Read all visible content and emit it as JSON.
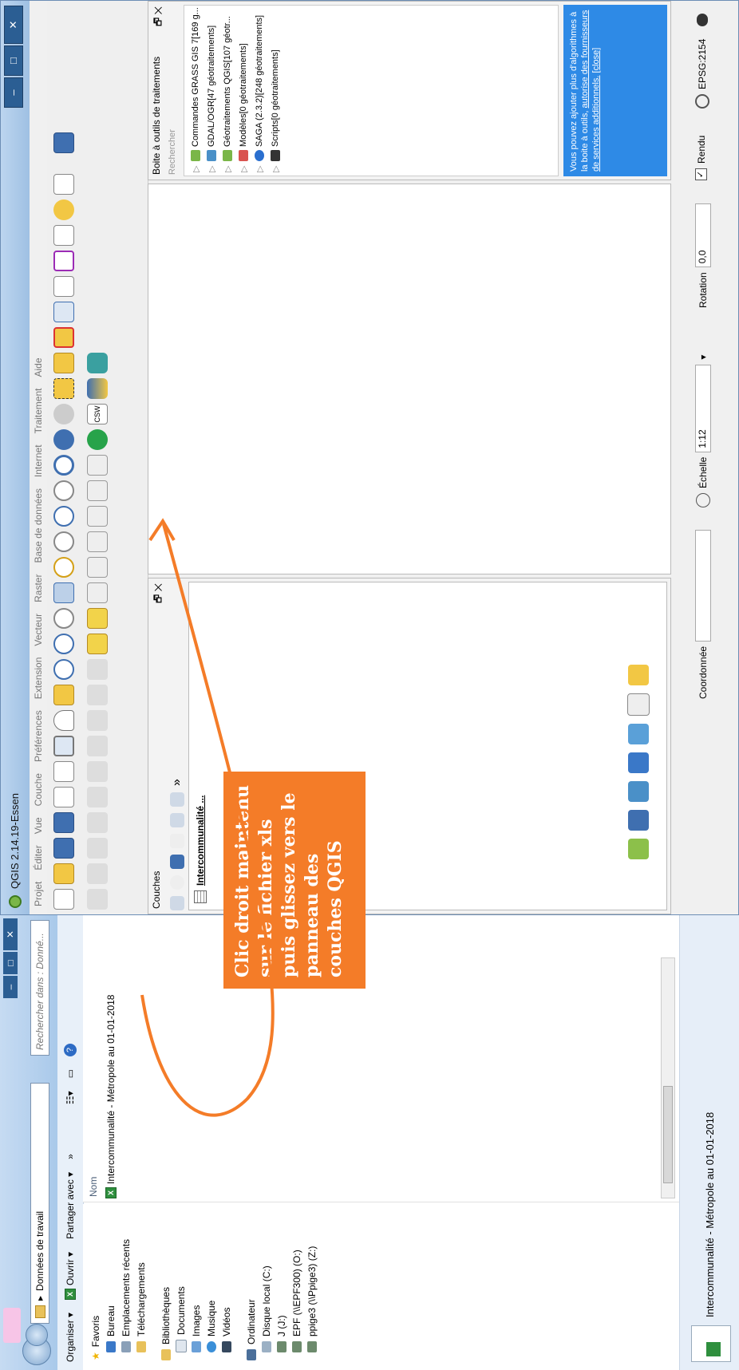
{
  "qgis": {
    "title": "QGIS 2.14.19-Essen",
    "window_buttons": [
      "–",
      "□",
      "✕"
    ],
    "menu": [
      "Projet",
      "Éditer",
      "Vue",
      "Couche",
      "Préférences",
      "Extension",
      "Vecteur",
      "Raster",
      "Base de données",
      "Internet",
      "Traitement",
      "Aide"
    ],
    "layers_panel": {
      "title": "Couches",
      "float_close": "🗗 ✕",
      "more": "»",
      "layer_name": "Intercommunalité ..."
    },
    "processing_panel": {
      "title": "Boite à outils de traitements",
      "float_close": "🗗 ✕",
      "search_placeholder": "Rechercher",
      "items": [
        "Commandes GRASS GIS 7[169 g...",
        "GDAL/OGR[47 géotraitements]",
        "Géotraitements QGIS[107 géotr...",
        "Modèles[0 géotraitements]",
        "SAGA (2.3.2)[248 géotraitements]",
        "Scripts[0 géotraitements]"
      ],
      "notice_text": "Vous pouvez ajouter plus d'algorithmes à la boite à outils,",
      "notice_link": "autorise des fournisseurs de services additionnels.",
      "notice_close": "[close]"
    },
    "status": {
      "coord_label": "Coordonnée",
      "coord_value": "",
      "scale_label": "Échelle",
      "scale_value": "1:12",
      "rotation_label": "Rotation",
      "rotation_value": "0,0",
      "render_label": "Rendu",
      "crs": "EPSG:2154"
    }
  },
  "explorer": {
    "window_buttons": [
      "–",
      "□",
      "✕"
    ],
    "address": "Données de travail",
    "search_placeholder": "Rechercher dans : Donné...",
    "toolbar": {
      "organize": "Organiser ▾",
      "open": "Ouvrir ▾",
      "share": "Partager avec ▾",
      "more": "»"
    },
    "nav": {
      "favorites": "Favoris",
      "fav_items": [
        "Bureau",
        "Emplacements récents",
        "Téléchargements"
      ],
      "libraries": "Bibliothèques",
      "lib_items": [
        "Documents",
        "Images",
        "Musique",
        "Vidéos"
      ],
      "computer": "Ordinateur",
      "comp_items": [
        "Disque local (C:)",
        "J (J:)",
        "EPF (\\\\EPF300) (O:)",
        "ppige3 (\\\\Ppige3) (Z:)"
      ]
    },
    "column_name": "Nom",
    "file_name": "Intercommunalité - Métropole au 01-01-2018",
    "status_name": "Intercommunalité - Métropole au 01-01-2018"
  },
  "annotation": {
    "text": "Clic droit maintenu sur le fichier xls puis glissez vers le panneau des couches QGIS"
  },
  "colors": {
    "annotation_bg": "#f47c28",
    "notice_bg": "#2e8ae6",
    "title_bar": "#a9c9ea"
  }
}
